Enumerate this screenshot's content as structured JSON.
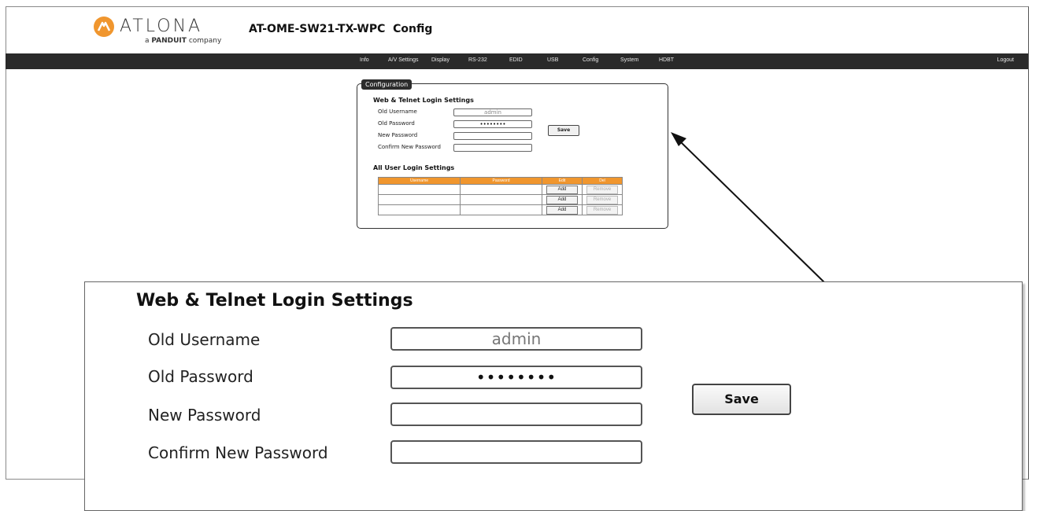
{
  "brand": {
    "name": "ATLONA",
    "sub_prefix": "a",
    "sub_brand": "PANDUIT",
    "sub_suffix": "company",
    "accent": "#f0962e"
  },
  "header": {
    "title": "AT-OME-SW21-TX-WPC  Config"
  },
  "nav": {
    "items": [
      "Info",
      "A/V Settings",
      "Display",
      "RS-232",
      "EDID",
      "USB",
      "Config",
      "System",
      "HDBT"
    ],
    "logout": "Logout"
  },
  "config": {
    "tab_label": "Configuration",
    "web_section": {
      "heading": "Web & Telnet Login Settings",
      "old_username_label": "Old Username",
      "old_username_value": "admin",
      "old_password_label": "Old Password",
      "old_password_value": "••••••••",
      "new_password_label": "New Password",
      "new_password_value": "",
      "confirm_password_label": "Confirm New Password",
      "confirm_password_value": "",
      "save_label": "Save"
    },
    "users_section": {
      "heading": "All User Login Settings",
      "columns": [
        "Username",
        "Password",
        "Edit",
        "Del"
      ],
      "rows": [
        {
          "username": "",
          "password": "",
          "edit": "Add",
          "del": "Remove"
        },
        {
          "username": "",
          "password": "",
          "edit": "Add",
          "del": "Remove"
        },
        {
          "username": "",
          "password": "",
          "edit": "Add",
          "del": "Remove"
        }
      ]
    }
  },
  "zoom": {
    "heading": "Web & Telnet Login Settings",
    "old_username_label": "Old Username",
    "old_username_value": "admin",
    "old_password_label": "Old Password",
    "old_password_value": "••••••••",
    "new_password_label": "New Password",
    "confirm_password_label": "Confirm New Password",
    "save_label": "Save"
  }
}
